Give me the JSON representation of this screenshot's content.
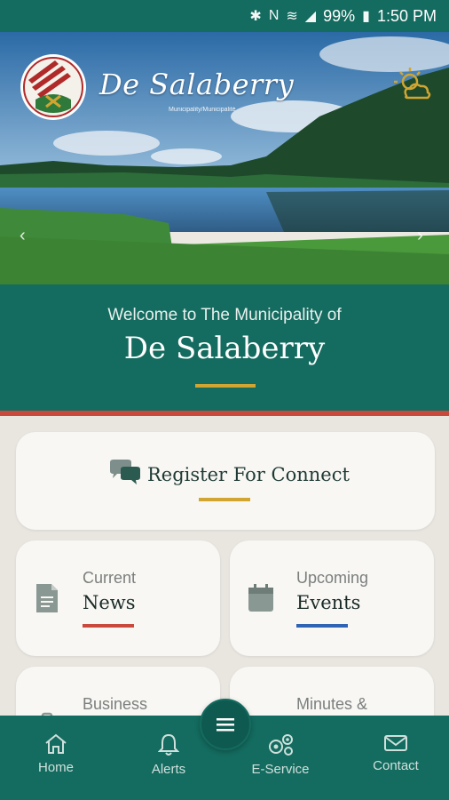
{
  "status_bar": {
    "battery": "99%",
    "time": "1:50 PM"
  },
  "hero": {
    "logo_title": "De Salaberry",
    "logo_subtitle": "Municipality/Municipalité"
  },
  "welcome": {
    "line1": "Welcome to The Municipality of",
    "line2": "De Salaberry"
  },
  "register": {
    "label": "Register For Connect"
  },
  "tiles": [
    {
      "top": "Current",
      "main": "News",
      "accent": "#c94a3c"
    },
    {
      "top": "Upcoming",
      "main": "Events",
      "accent": "#2f63b3"
    },
    {
      "top": "Business",
      "main": "",
      "accent": "#d1a531"
    },
    {
      "top": "Minutes &",
      "main": "",
      "accent": "#d1a531"
    }
  ],
  "bottom_nav": [
    {
      "label": "Home",
      "icon": "home-icon"
    },
    {
      "label": "Alerts",
      "icon": "bell-icon"
    },
    {
      "label": "E-Service",
      "icon": "gears-icon"
    },
    {
      "label": "Contact",
      "icon": "envelope-icon"
    }
  ],
  "colors": {
    "primary": "#146b5f",
    "gold": "#d1a531",
    "red": "#c94a3c",
    "blue": "#2f63b3"
  }
}
